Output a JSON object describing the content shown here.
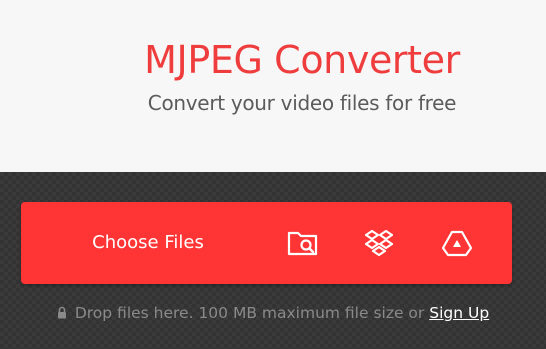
{
  "hero": {
    "title": "MJPEG Converter",
    "subtitle": "Convert your video files for free"
  },
  "upload": {
    "choose_files_label": "Choose Files",
    "sources": [
      {
        "name": "From Device",
        "icon": "folder-search-icon"
      },
      {
        "name": "From Dropbox",
        "icon": "dropbox-icon"
      },
      {
        "name": "From Google Drive",
        "icon": "google-drive-icon"
      }
    ]
  },
  "hint": {
    "lock_icon": "lock-icon",
    "text": "Drop files here. 100 MB maximum file size or",
    "signup_label": "Sign Up"
  },
  "colors": {
    "accent": "#ff3535",
    "title": "#ef3d3d",
    "subtitle": "#5b5b5b",
    "dropzone_bg": "#363636",
    "hint": "#8a8a8a"
  }
}
